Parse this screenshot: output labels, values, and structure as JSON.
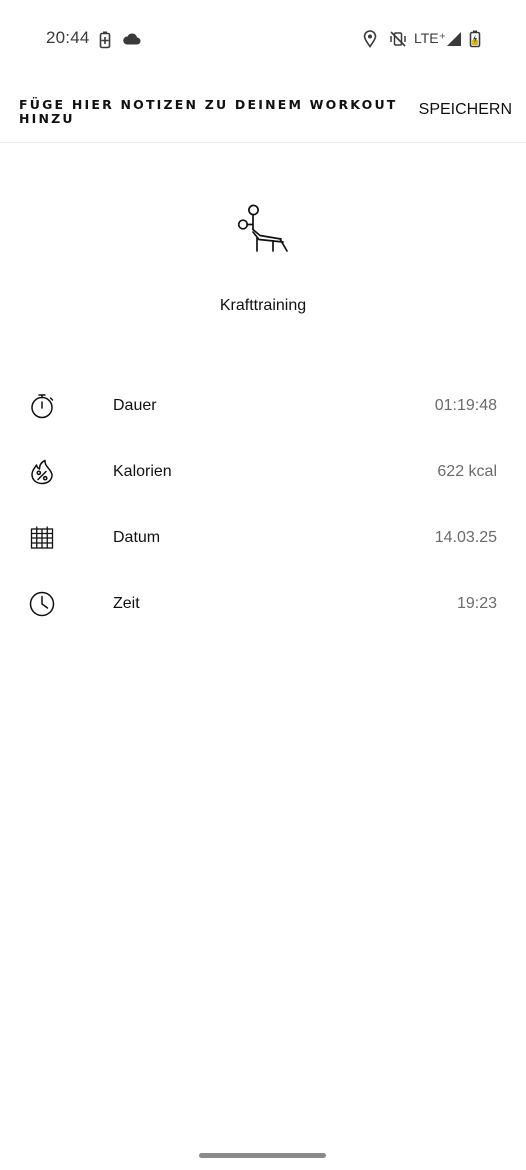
{
  "status_bar": {
    "time": "20:44",
    "network": "LTE⁺"
  },
  "header": {
    "title": "FÜGE HIER NOTIZEN ZU DEINEM WORKOUT HINZU",
    "save_label": "SPEICHERN"
  },
  "activity": {
    "icon": "weight-bench-icon",
    "name": "Krafttraining"
  },
  "stats": [
    {
      "icon": "stopwatch-icon",
      "label": "Dauer",
      "value": "01:19:48"
    },
    {
      "icon": "flame-percent-icon",
      "label": "Kalorien",
      "value": "622 kcal"
    },
    {
      "icon": "calendar-grid-icon",
      "label": "Datum",
      "value": "14.03.25"
    },
    {
      "icon": "clock-icon",
      "label": "Zeit",
      "value": "19:23"
    }
  ]
}
